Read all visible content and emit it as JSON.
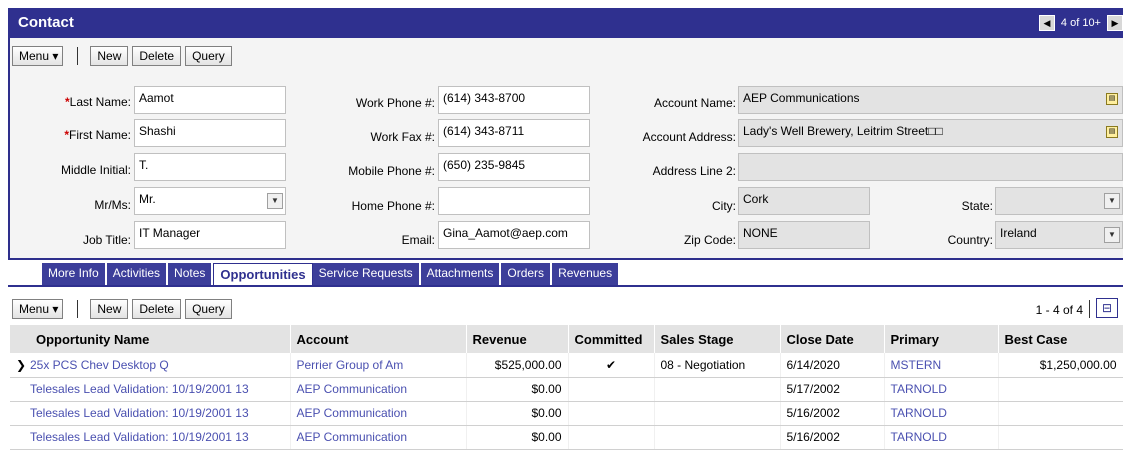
{
  "contact": {
    "title": "Contact",
    "record_nav": {
      "count": "4 of 10+",
      "prev_icon": "◀",
      "next_icon": "▶"
    },
    "toolbar": {
      "menu": "Menu ▾",
      "new": "New",
      "delete": "Delete",
      "query": "Query"
    },
    "form": {
      "last_name": {
        "label": "Last Name:",
        "value": "Aamot",
        "required": "*"
      },
      "first_name": {
        "label": "First Name:",
        "value": "Shashi",
        "required": "*"
      },
      "middle_initial": {
        "label": "Middle Initial:",
        "value": "T."
      },
      "mr_ms": {
        "label": "Mr/Ms:",
        "value": "Mr."
      },
      "job_title": {
        "label": "Job Title:",
        "value": "IT Manager"
      },
      "work_phone": {
        "label": "Work Phone #:",
        "value": "(614) 343-8700"
      },
      "work_fax": {
        "label": "Work Fax #:",
        "value": "(614) 343-8711"
      },
      "mobile_phone": {
        "label": "Mobile Phone #:",
        "value": "(650) 235-9845"
      },
      "home_phone": {
        "label": "Home Phone #:",
        "value": ""
      },
      "email": {
        "label": "Email:",
        "value": "Gina_Aamot@aep.com"
      },
      "account_name": {
        "label": "Account Name:",
        "value": "AEP Communications"
      },
      "account_address": {
        "label": "Account Address:",
        "value": "Lady's Well Brewery, Leitrim Street□□"
      },
      "address_line2": {
        "label": "Address Line 2:",
        "value": ""
      },
      "city": {
        "label": "City:",
        "value": "Cork"
      },
      "state": {
        "label": "State:",
        "value": ""
      },
      "zip": {
        "label": "Zip Code:",
        "value": "NONE"
      },
      "country": {
        "label": "Country:",
        "value": "Ireland"
      }
    }
  },
  "tabs": [
    {
      "label": "More Info"
    },
    {
      "label": "Activities"
    },
    {
      "label": "Notes"
    },
    {
      "label": "Opportunities",
      "active": true
    },
    {
      "label": "Service Requests"
    },
    {
      "label": "Attachments"
    },
    {
      "label": "Orders"
    },
    {
      "label": "Revenues"
    }
  ],
  "opportunities": {
    "toolbar": {
      "menu": "Menu ▾",
      "new": "New",
      "delete": "Delete",
      "query": "Query"
    },
    "count": "1 - 4 of 4",
    "columns": [
      "Opportunity Name",
      "Account",
      "Revenue",
      "Committed",
      "Sales Stage",
      "Close Date",
      "Primary",
      "Best Case"
    ],
    "rows": [
      {
        "selector": "❯",
        "name": "25x PCS Chev Desktop Q",
        "account": "Perrier Group of Am",
        "revenue": "$525,000.00",
        "committed": "✔",
        "stage": "08 - Negotiation",
        "close": "6/14/2020",
        "primary": "MSTERN",
        "best": "$1,250,000.00"
      },
      {
        "selector": "",
        "name": "Telesales Lead Validation: 10/19/2001 13",
        "account": "AEP Communication",
        "revenue": "$0.00",
        "committed": "",
        "stage": "",
        "close": "5/17/2002",
        "primary": "TARNOLD",
        "best": ""
      },
      {
        "selector": "",
        "name": "Telesales Lead Validation: 10/19/2001 13",
        "account": "AEP Communication",
        "revenue": "$0.00",
        "committed": "",
        "stage": "",
        "close": "5/16/2002",
        "primary": "TARNOLD",
        "best": ""
      },
      {
        "selector": "",
        "name": "Telesales Lead Validation: 10/19/2001 13",
        "account": "AEP Communication",
        "revenue": "$0.00",
        "committed": "",
        "stage": "",
        "close": "5/16/2002",
        "primary": "TARNOLD",
        "best": ""
      }
    ]
  },
  "colors": {
    "brand": "#2f308f",
    "link": "#4a50b0",
    "required": "#cc0000"
  }
}
